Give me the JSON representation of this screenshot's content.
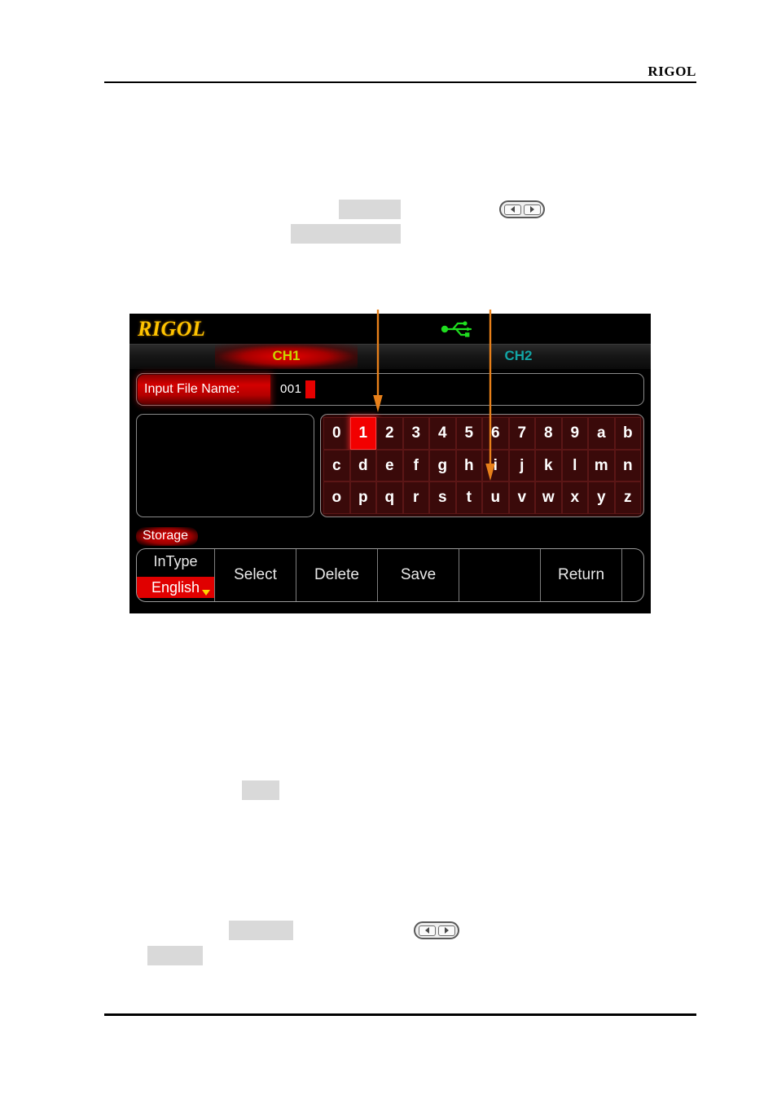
{
  "page": {
    "header_brand": "RIGOL"
  },
  "device": {
    "logo": "RIGOL",
    "usb_icon": "usb-icon",
    "channel_tabs": [
      {
        "label": "CH1",
        "active": true,
        "color": "#c8d400"
      },
      {
        "label": "CH2",
        "active": false,
        "color": "#12a5a5"
      }
    ],
    "filename_field": {
      "label": "Input File Name:",
      "value": "001",
      "cursor": true
    },
    "preview_panel": {
      "content": ""
    },
    "keyboard": {
      "selected_key": "1",
      "rows": [
        [
          "0",
          "1",
          "2",
          "3",
          "4",
          "5",
          "6",
          "7",
          "8",
          "9",
          "a",
          "b"
        ],
        [
          "c",
          "d",
          "e",
          "f",
          "g",
          "h",
          "i",
          "j",
          "k",
          "l",
          "m",
          "n"
        ],
        [
          "o",
          "p",
          "q",
          "r",
          "s",
          "t",
          "u",
          "v",
          "w",
          "x",
          "y",
          "z"
        ]
      ]
    },
    "storage_tab": "Storage",
    "menu": {
      "intype": {
        "label": "InType",
        "value": "English"
      },
      "items": [
        "Select",
        "Delete",
        "Save",
        "",
        "Return",
        ""
      ]
    }
  },
  "colors": {
    "accent_red": "#e60000",
    "brand_yellow": "#ffc400",
    "ch1_green": "#c8d400",
    "ch2_teal": "#12a5a5",
    "usb_green": "#1fdd1f",
    "callout_orange": "#e8801a",
    "redaction_gray": "#d9d9d9"
  }
}
